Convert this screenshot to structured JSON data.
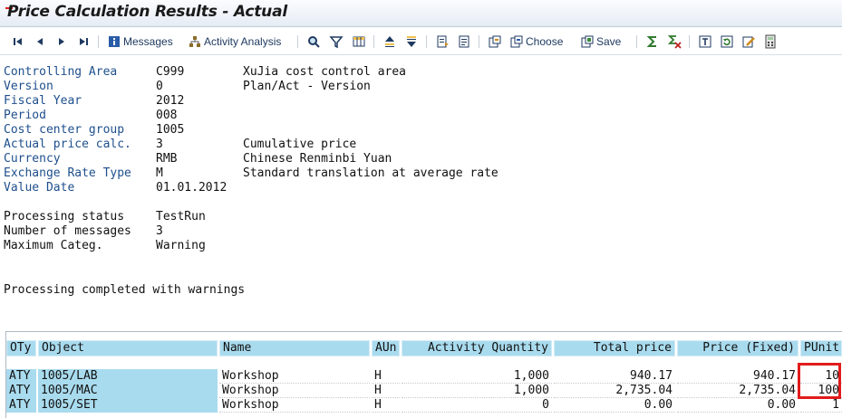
{
  "window": {
    "title": "Price Calculation Results - Actual"
  },
  "toolbar": {
    "messages_label": "Messages",
    "activity_analysis_label": "Activity Analysis",
    "choose_label": "Choose",
    "save_label": "Save"
  },
  "header": {
    "rows": [
      {
        "label": "Controlling Area",
        "value": "C999",
        "desc": "XuJia cost control area"
      },
      {
        "label": "Version",
        "value": "0",
        "desc": "Plan/Act - Version"
      },
      {
        "label": "Fiscal Year",
        "value": "2012",
        "desc": ""
      },
      {
        "label": "Period",
        "value": "008",
        "desc": ""
      },
      {
        "label": "Cost center group",
        "value": "1005",
        "desc": ""
      },
      {
        "label": "Actual price calc.",
        "value": "3",
        "desc": "Cumulative price"
      },
      {
        "label": "Currency",
        "value": "RMB",
        "desc": "Chinese Renminbi Yuan"
      },
      {
        "label": "Exchange Rate Type",
        "value": "M",
        "desc": "Standard translation at average rate"
      },
      {
        "label": "Value Date",
        "value": "01.01.2012",
        "desc": ""
      }
    ],
    "processing": [
      {
        "label": "Processing status",
        "value": "TestRun"
      },
      {
        "label": "Number of messages",
        "value": "3"
      },
      {
        "label": "Maximum Categ.",
        "value": "Warning"
      }
    ],
    "status_message": "Processing completed with warnings"
  },
  "table": {
    "columns": [
      "OTy",
      "Object",
      "Name",
      "AUn",
      "Activity Quantity",
      "Total price",
      "Price (Fixed)",
      "PUnit"
    ],
    "rows": [
      [
        "ATY",
        "1005/LAB",
        "Workshop",
        "H",
        "1,000",
        "940.17",
        "940.17",
        "10"
      ],
      [
        "ATY",
        "1005/MAC",
        "Workshop",
        "H",
        "1,000",
        "2,735.04",
        "2,735.04",
        "100"
      ],
      [
        "ATY",
        "1005/SET",
        "Workshop",
        "H",
        "0",
        "0.00",
        "0.00",
        "1"
      ]
    ]
  },
  "colors": {
    "header_blue": "#a9dbee",
    "label_blue": "#1e4f8c",
    "highlight_red": "#e21b1b"
  }
}
